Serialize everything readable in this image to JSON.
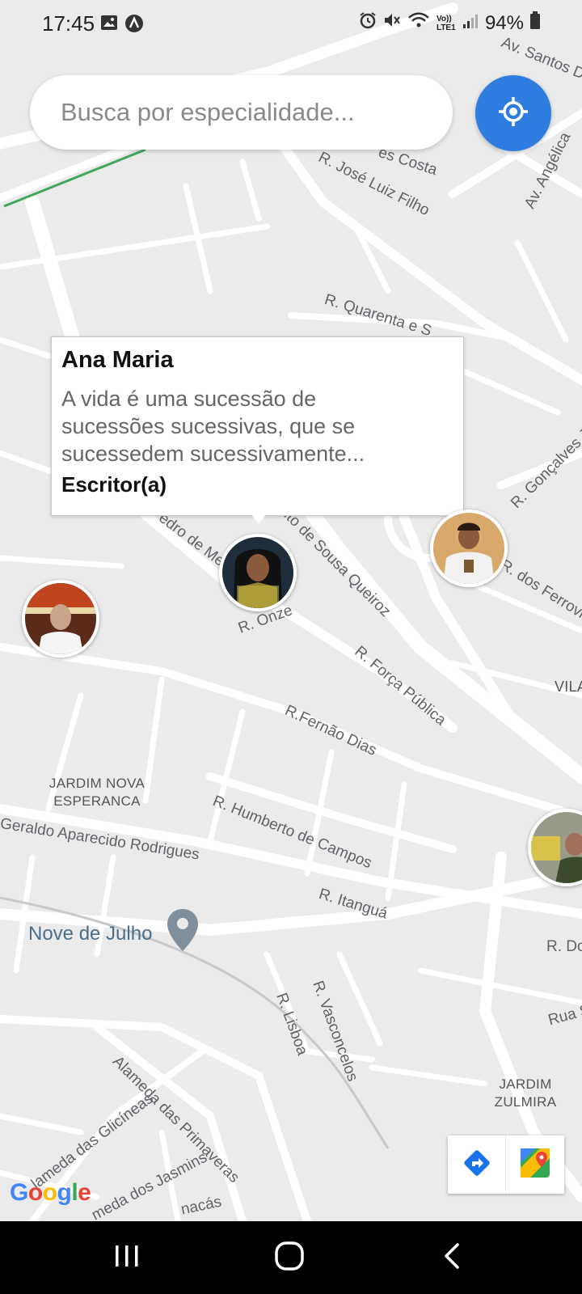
{
  "status_bar": {
    "time": "17:45",
    "battery": "94%",
    "app_icons": [
      "image-icon",
      "app-a-icon"
    ],
    "system_icons": [
      "alarm-icon",
      "mute-icon",
      "wifi-icon",
      "volte-icon",
      "signal-icon",
      "battery-icon"
    ],
    "volte_label": "Vo)) LTE1"
  },
  "search": {
    "placeholder": "Busca por especialidade..."
  },
  "map": {
    "streets": [
      "Av. Santos Du",
      "es Costa",
      "R. José Luiz Filho",
      "Av. Angélica",
      "R. Quarenta e S",
      "R. Gonçalves Ju",
      "edro de Me",
      "cito de Sousa Queiroz",
      "R. dos Ferrovi",
      "R. Onze",
      "VILA",
      "R. Força Pública",
      "R.Fernão Dias",
      "R. Humberto de Campos",
      "Geraldo Aparecido Rodrigues",
      "R. Itanguá",
      "R. Do",
      "Rua S",
      "R. Lisboa",
      "R. Vasconcelos",
      "Alameda das Primaveras",
      "lameda das Glicíneas",
      "meda dos Jasmins",
      "nacás"
    ],
    "districts": [
      "JARDIM NOVA ESPERANCA",
      "JARDIM ZULMIRA"
    ],
    "poi": "Nove de Julho",
    "google_logo": [
      "G",
      "o",
      "o",
      "g",
      "l",
      "e"
    ],
    "google_colors": [
      "#4285F4",
      "#EA4335",
      "#FBBC05",
      "#4285F4",
      "#34A853",
      "#EA4335"
    ]
  },
  "info_window": {
    "name": "Ana Maria",
    "bio": "A vida é uma sucessão de sucessões sucessivas, que se sucessedem sucessivamente...",
    "role": "Escritor(a)"
  },
  "markers": [
    {
      "id": "ana-maria",
      "selected": true
    },
    {
      "id": "chef"
    },
    {
      "id": "young-man"
    },
    {
      "id": "worker"
    }
  ],
  "colors": {
    "accent": "#2f7de1",
    "map_bg": "#eaeaea",
    "road": "#ffffff"
  }
}
